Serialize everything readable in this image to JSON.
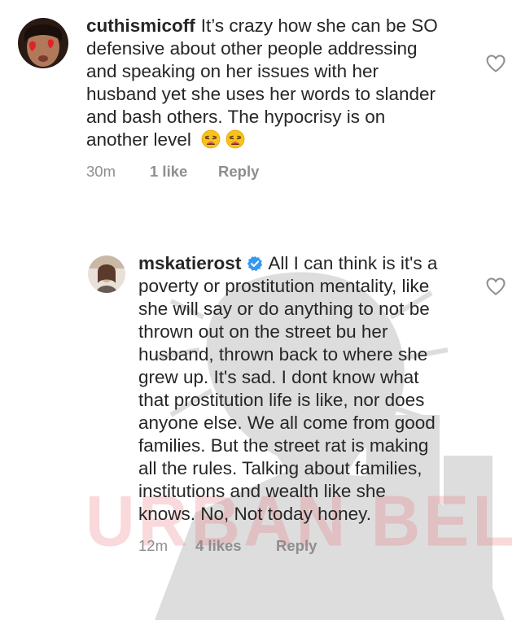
{
  "watermark": {
    "text": "URBAN BELLE"
  },
  "comments": [
    {
      "username": "cuthismicoff",
      "text": "It’s crazy how she can be SO defensive about other people addressing and speaking on her issues with her husband yet she uses her words to slander and bash others. The hypocrisy is on another level",
      "emojis": [
        "weary-face",
        "weary-face"
      ],
      "time": "30m",
      "likes": "1 like",
      "reply_label": "Reply",
      "verified": false
    },
    {
      "username": "mskatierost",
      "text": "All I can think is it's a poverty or prostitution mentality, like she will say or do anything to not be thrown out on the street bu her husband, thrown back to where she grew up. It's sad. I dont know what that prostitution life is like, nor does anyone else. We all come from good families. But the street rat is making all the rules. Talking about families, institutions and wealth like she knows. No, Not today honey.",
      "time": "12m",
      "likes": "4 likes",
      "reply_label": "Reply",
      "verified": true
    }
  ],
  "colors": {
    "text": "#262626",
    "meta": "#8e8e8e",
    "verified": "#3897f0"
  },
  "icons": {
    "like": "heart-outline-icon",
    "verified": "verified-badge-icon"
  }
}
